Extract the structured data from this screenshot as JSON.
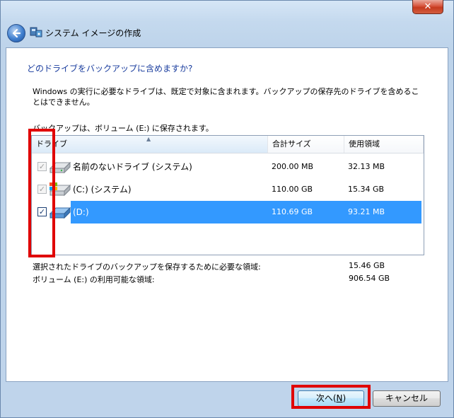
{
  "window": {
    "title": "システム イメージの作成",
    "close_label": "✕"
  },
  "page": {
    "heading": "どのドライブをバックアップに含めますか?",
    "description": "Windows の実行に必要なドライブは、既定で対象に含まれます。バックアップの保存先のドライブを含めることはできません。",
    "save_location": "バックアップは、ボリューム (E:) に保存されます。"
  },
  "drive_list": {
    "columns": {
      "drive": "ドライブ",
      "size": "合計サイズ",
      "used": "使用領域"
    },
    "rows": [
      {
        "name": "名前のないドライブ (システム)",
        "size": "200.00 MB",
        "used": "32.13 MB",
        "checked": true,
        "enabled": false,
        "selected": false
      },
      {
        "name": "(C:) (システム)",
        "size": "110.00 GB",
        "used": "15.34 GB",
        "checked": true,
        "enabled": false,
        "selected": false
      },
      {
        "name": "(D:)",
        "size": "110.69 GB",
        "used": "93.21 MB",
        "checked": true,
        "enabled": true,
        "selected": true
      }
    ]
  },
  "summary": {
    "required_label": "選択されたドライブのバックアップを保存するために必要な領域:",
    "required_value": "15.46 GB",
    "available_label": "ボリューム (E:) の利用可能な領域:",
    "available_value": "906.54 GB"
  },
  "buttons": {
    "next_label": "次へ(",
    "next_accel": "N",
    "next_close": ")",
    "cancel_label": "キャンセル"
  },
  "colors": {
    "highlight_box": "#e00000",
    "selection": "#3399ff",
    "heading": "#1a3d9e"
  }
}
